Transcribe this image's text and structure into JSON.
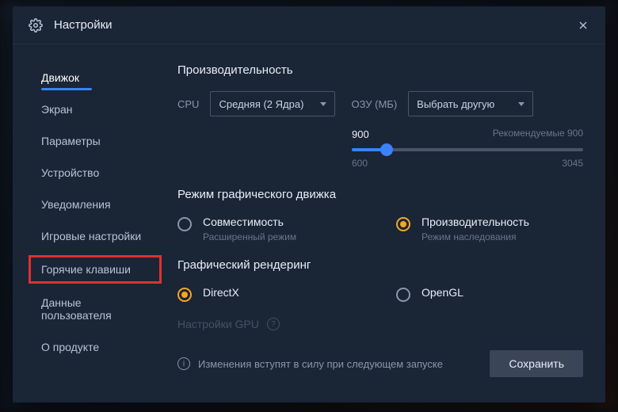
{
  "title": "Настройки",
  "sidebar": {
    "items": [
      {
        "label": "Движок"
      },
      {
        "label": "Экран"
      },
      {
        "label": "Параметры"
      },
      {
        "label": "Устройство"
      },
      {
        "label": "Уведомления"
      },
      {
        "label": "Игровые настройки"
      },
      {
        "label": "Горячие клавиши"
      },
      {
        "label": "Данные пользователя"
      },
      {
        "label": "О продукте"
      }
    ]
  },
  "perf": {
    "title": "Производительность",
    "cpu_label": "CPU",
    "cpu_value": "Средняя (2 Ядра)",
    "ram_label": "ОЗУ (МБ)",
    "ram_value": "Выбрать другую",
    "slider": {
      "value": "900",
      "recommended": "Рекомендуемые 900",
      "min": "600",
      "max": "3045"
    }
  },
  "engine_mode": {
    "title": "Режим графического движка",
    "opt1": {
      "label": "Совместимость",
      "sub": "Расширенный режим"
    },
    "opt2": {
      "label": "Производительность",
      "sub": "Режим наследования"
    }
  },
  "rendering": {
    "title": "Графический рендеринг",
    "opt1": "DirectX",
    "opt2": "OpenGL"
  },
  "gpu": {
    "label": "Настройки GPU"
  },
  "footer": {
    "notice": "Изменения вступят в силу при следующем запуске",
    "save": "Сохранить"
  }
}
